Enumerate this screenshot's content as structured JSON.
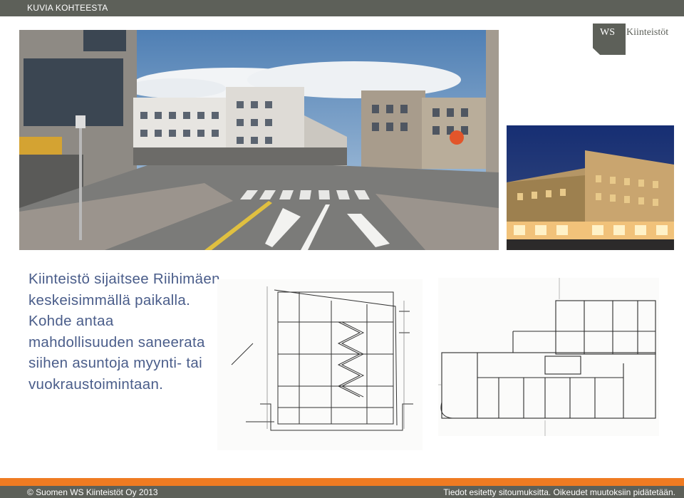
{
  "header": {
    "title": "KUVIA KOHTEESTA"
  },
  "logo": {
    "mark": "WS",
    "name": "Kiinteistöt"
  },
  "body": {
    "text": "Kiinteistö sijaitsee Riihimäen keskeisimmällä paikalla. Kohde antaa mahdollisuuden saneerata siihen asuntoja myynti- tai vuokraustoimintaan."
  },
  "footer": {
    "copyright": "© Suomen WS Kiinteistöt Oy 2013",
    "disclaimer": "Tiedot esitetty sitoumuksitta. Oikeudet muutoksiin pidätetään."
  },
  "colors": {
    "bar": "#5d6059",
    "accent": "#ef7b22",
    "text": "#4a5d8a"
  }
}
